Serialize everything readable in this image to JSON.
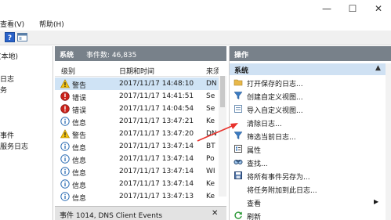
{
  "window": {
    "minimize_glyph": "—",
    "maximize_glyph": "☐",
    "close_glyph": "✕"
  },
  "menubar": {
    "view": "查看(V)",
    "help": "帮助(H)"
  },
  "left_pane": {
    "items": [
      "(本地)",
      "日志",
      "务",
      "事件",
      "服务日志"
    ]
  },
  "event_list": {
    "header_title": "系统",
    "event_count": "事件数: 46,835",
    "columns": {
      "level": "级别",
      "datetime": "日期和时间",
      "source": "来须"
    },
    "rows": [
      {
        "icon": "warning-icon",
        "level": "警告",
        "datetime": "2017/11/17 14:48:10",
        "source": "DN"
      },
      {
        "icon": "error-icon",
        "level": "错误",
        "datetime": "2017/11/17 14:41:51",
        "source": "Se"
      },
      {
        "icon": "error-icon",
        "level": "错误",
        "datetime": "2017/11/17 14:04:54",
        "source": "Se"
      },
      {
        "icon": "info-icon",
        "level": "信息",
        "datetime": "2017/11/17 13:47:21",
        "source": "Ke"
      },
      {
        "icon": "warning-icon",
        "level": "警告",
        "datetime": "2017/11/17 13:47:20",
        "source": "DN"
      },
      {
        "icon": "info-icon",
        "level": "信息",
        "datetime": "2017/11/17 13:47:14",
        "source": "BT"
      },
      {
        "icon": "info-icon",
        "level": "信息",
        "datetime": "2017/11/17 13:47:14",
        "source": "Po"
      },
      {
        "icon": "info-icon",
        "level": "信息",
        "datetime": "2017/11/17 13:47:14",
        "source": "WI"
      },
      {
        "icon": "info-icon",
        "level": "信息",
        "datetime": "2017/11/17 13:47:14",
        "source": "Ke"
      },
      {
        "icon": "info-icon",
        "level": "信息",
        "datetime": "2017/11/17 13:47:13",
        "source": "Ke"
      }
    ],
    "detail_title": "事件 1014, DNS Client Events"
  },
  "actions_pane": {
    "header": "操作",
    "section": "系统",
    "items": [
      {
        "icon": "folder-open-icon",
        "label": "打开保存的日志..."
      },
      {
        "icon": "filter-icon",
        "label": "创建自定义视图..."
      },
      {
        "icon": "import-view-icon",
        "label": "导入自定义视图..."
      },
      {
        "icon": "clear-log-icon",
        "label": "清除日志..."
      },
      {
        "icon": "filter-icon",
        "label": "筛选当前日志..."
      },
      {
        "icon": "properties-icon",
        "label": "属性"
      },
      {
        "icon": "find-icon",
        "label": "查找..."
      },
      {
        "icon": "save-icon",
        "label": "将所有事件另存为..."
      },
      {
        "icon": "attach-task-icon",
        "label": "将任务附加到此日志..."
      },
      {
        "icon": "view-icon",
        "label": "查看"
      },
      {
        "icon": "refresh-icon",
        "label": "刷新"
      }
    ]
  },
  "colors": {
    "pane_header": "#78818a",
    "selected_row": "#cfe3f5",
    "arrow": "#e8322c"
  }
}
